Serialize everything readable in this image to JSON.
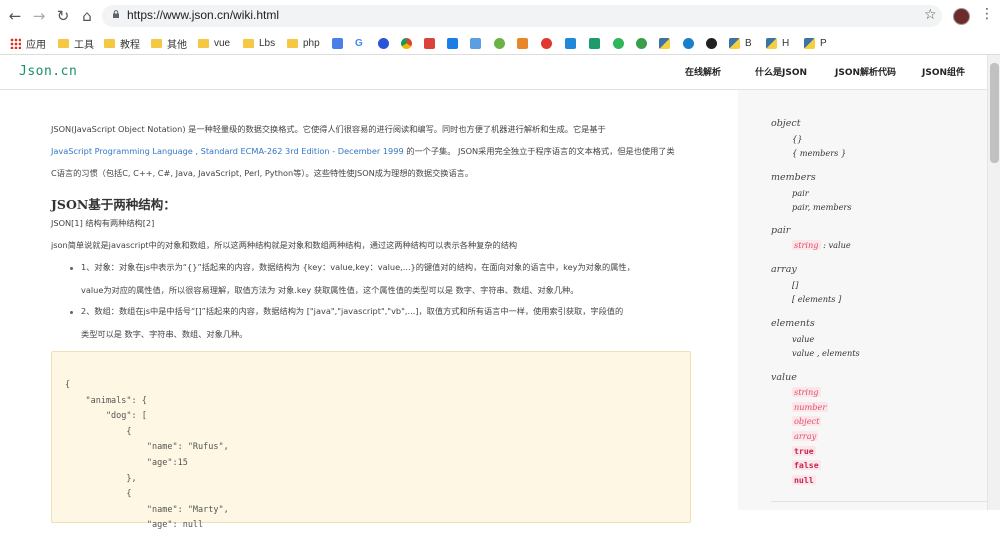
{
  "browser": {
    "url": "https://www.json.cn/wiki.html",
    "bookmarks": [
      "应用",
      "工具",
      "教程",
      "其他",
      "vue",
      "Lbs",
      "php",
      "G",
      "B",
      "H",
      "P"
    ]
  },
  "site": {
    "logo": "Json.cn",
    "nav": [
      "在线解析",
      "什么是JSON",
      "JSON解析代码",
      "JSON组件"
    ]
  },
  "article": {
    "intro_line1": "JSON(JavaScript Object Notation) 是一种轻量级的数据交换格式。它使得人们很容易的进行阅读和编写。同时也方便了机器进行解析和生成。它是基于",
    "intro_line2_link": "JavaScript Programming Language , Standard ECMA-262 3rd Edition - December 1999",
    "intro_line2_rest": " 的一个子集。 JSON采用完全独立于程序语言的文本格式，但是也使用了类",
    "intro_line3": "C语言的习惯（包括C, C++, C#, Java, JavaScript, Perl, Python等）。这些特性使JSON成为理想的数据交换语言。",
    "heading": "JSON基于两种结构：",
    "ref_line": "JSON[1] 结构有两种结构[2]",
    "desc_line": "json简单说就是javascript中的对象和数组，所以这两种结构就是对象和数组两种结构，通过这两种结构可以表示各种复杂的结构",
    "bullet1_line1": "1、对象：对象在js中表示为“{}”括起来的内容，数据结构为 {key：value,key：value,...}的键值对的结构，在面向对象的语言中，key为对象的属性，",
    "bullet1_line2": "value为对应的属性值，所以很容易理解，取值方法为 对象.key 获取属性值，这个属性值的类型可以是 数字、字符串、数组、对象几种。",
    "bullet2_line1": "2、数组：数组在js中是中括号“[]”括起来的内容，数据结构为 [\"java\",\"javascript\",\"vb\",...]，取值方式和所有语言中一样，使用索引获取，字段值的",
    "bullet2_line2": "类型可以是 数字、字符串、数组、对象几种。",
    "code": "{\n    \"animals\": {\n        \"dog\": [\n            {\n                \"name\": \"Rufus\",\n                \"age\":15\n            },\n            {\n                \"name\": \"Marty\",\n                \"age\": null"
  },
  "grammar": {
    "object_title": "object",
    "object_items": [
      "{}",
      "{ members }"
    ],
    "members_title": "members",
    "members_items": [
      "pair",
      "pair, members"
    ],
    "pair_title": "pair",
    "pair_string": "string",
    "pair_rest": " : value",
    "array_title": "array",
    "array_items": [
      "[]",
      "[ elements ]"
    ],
    "elements_title": "elements",
    "elements_items": [
      "value",
      "value , elements"
    ],
    "value_title": "value",
    "value_items": [
      "string",
      "number",
      "object",
      "array",
      "true",
      "false",
      "null"
    ]
  },
  "colors": {
    "logo": "#1a8f6a",
    "link": "#3478c6",
    "code_bg": "#fdf7e3",
    "highlight_text": "#e0506a"
  }
}
